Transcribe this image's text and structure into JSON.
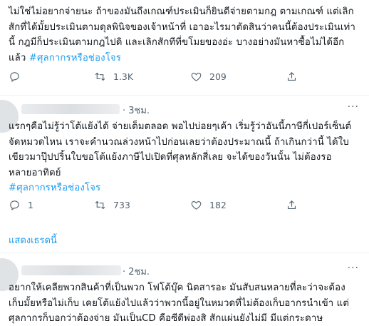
{
  "tweet1": {
    "line1": "ไม่ใช่ไม่อยากจ่ายนะ ถ้าของมันถึงเกณฑ์ประเมินก็ยินดีจ่ายตามกฎ ตามเกณฑ์ แต่เลิก",
    "line2": "สักที่ได้มั้ยประเมินตามดุลพินิจของเจ้าหน้าที่ เอาอะไรมาตัดสินว่าคนนี้ต้องประเมินเท่า",
    "line3": "นี้ กฎมีก็ประเมินตามกฎไปดิ และเลิกสักทีที่ขโมยของอ่ะ บางอย่างมันหาซื้อไม่ได้อีก",
    "line4_prefix": "แล้ว  ",
    "hashtag": "#ศุลกากรหรือช่องโจร",
    "retweets": "1.3K",
    "likes": "209"
  },
  "tweet2": {
    "time": "· 3ชม.",
    "line1": "แรกๆคือไม่รู้ว่าโต้แย้งได้ จ่ายเต็มตลอด พอไปบ่อยๆเค้า เริ่มรู้ว่าอันนี้ภาษีกี่เปอร์เซ็นต์",
    "line2": "จัดหมวดไหน เราจะคำนวณล่วงหน้าไปก่อนเลยว่าต้องประมาณนี้ ถ้าเกินกว่านี้ ได้ใบ",
    "line3": "เขียวมาปุ๊ปปริ้นใบขอโต้แย้งภาษีไปเปิดที่ศุลหลักสี่เลย จะได้ของวันนั้น ไม่ต้องรอ",
    "line4": "หลายอาทิตย์",
    "hashtag": "#ศุลกากรหรือช่องโจร",
    "replies": "1",
    "retweets": "733",
    "likes": "182"
  },
  "show_thread": "แสดงเธรดนี้",
  "tweet3": {
    "time": "· 2ชม.",
    "line1": "อยากให้เคลียพวกสินค้าที่เป็นพวก โฟโต้บุ๊ค นิตสารอะ มันสับสนหลายที่ละว่าจะต้อง",
    "line2": "เก็บมั้ยหรือไม่เก็บ เคยโต้แย้งไปแล้วว่าพวกนี้อยู่ในหมวดที่ไม่ต้องเก็บอากรนำเข้า แต่",
    "line3": "ศุลกากรก็บอกว่าต้องจ่าย มันเป็นCD คือซีดีพ่องสิ สักแผ่นยังไม่มี มีแต่กระดาษ"
  }
}
